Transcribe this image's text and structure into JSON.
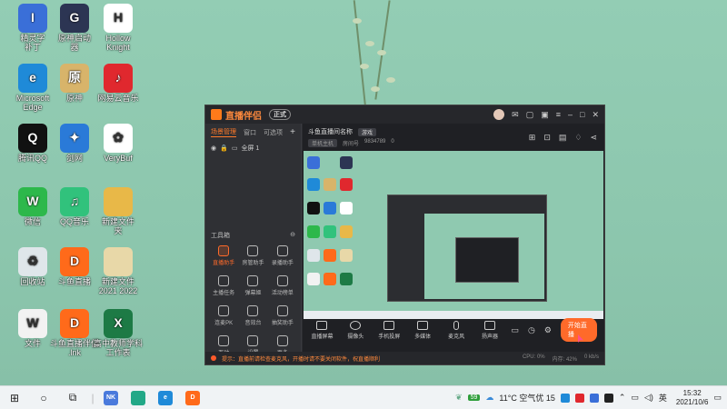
{
  "desktop": {
    "icons": [
      {
        "label": "精灵字\n补丁",
        "color": "#3a6fd8",
        "glyph": "I",
        "icon": "app-icon"
      },
      {
        "label": "原神启动\n器",
        "color": "#2c3553",
        "glyph": "G",
        "icon": "genshin-icon"
      },
      {
        "label": "Hollow\nKnight",
        "color": "#ffffff",
        "glyph": "H",
        "icon": "hollow-knight-icon"
      },
      {
        "label": "Microsoft\nEdge",
        "color": "#1f8ad8",
        "glyph": "e",
        "icon": "edge-icon"
      },
      {
        "label": "原神",
        "color": "#d8b46a",
        "glyph": "原",
        "icon": "genshin-game-icon"
      },
      {
        "label": "网易云音乐",
        "color": "#e0282e",
        "glyph": "♪",
        "icon": "netease-music-icon"
      },
      {
        "label": "腾讯QQ",
        "color": "#111111",
        "glyph": "Q",
        "icon": "qq-icon"
      },
      {
        "label": "剑网",
        "color": "#2a7ad8",
        "glyph": "✦",
        "icon": "game-icon"
      },
      {
        "label": "VeryBuf",
        "color": "#ffffff",
        "glyph": "✿",
        "icon": "pinwheel-icon"
      },
      {
        "label": "微信",
        "color": "#2db84b",
        "glyph": "W",
        "icon": "wechat-icon"
      },
      {
        "label": "QQ音乐",
        "color": "#31c27c",
        "glyph": "♫",
        "icon": "qq-music-icon"
      },
      {
        "label": "新建文件\n夹",
        "color": "#e8b848",
        "glyph": "",
        "icon": "folder-icon"
      },
      {
        "label": "回收站",
        "color": "#dfe6ea",
        "glyph": "♻",
        "icon": "recycle-bin-icon"
      },
      {
        "label": "斗鱼直播",
        "color": "#ff6a1a",
        "glyph": "D",
        "icon": "douyu-icon"
      },
      {
        "label": "新建文件\n2021 2022",
        "color": "#e8d8a8",
        "glyph": "",
        "icon": "document-icon"
      },
      {
        "label": "文件",
        "color": "#f2f2f2",
        "glyph": "W",
        "icon": "word-doc-icon"
      },
      {
        "label": "斗鱼直播伴侣\n.lnk",
        "color": "#ff6a1a",
        "glyph": "D",
        "icon": "douyu-companion-icon"
      },
      {
        "label": "高中教师学科\n工作表",
        "color": "#1d7a45",
        "glyph": "X",
        "icon": "excel-icon"
      }
    ]
  },
  "app": {
    "brand": "直播伴侣",
    "version": "正式",
    "tabs": [
      "场景管理",
      "窗口",
      "可选项"
    ],
    "scene_item": "全屏 1",
    "toolbox_title": "工具箱",
    "tools": [
      "直播助手",
      "房管助手",
      "录播助手",
      "主播任务",
      "弹幕姬",
      "活动榜单",
      "连麦PK",
      "音效台",
      "抽奖助手",
      "互动",
      "设置",
      "更多"
    ],
    "room": {
      "title": "斗鱼直播间名称",
      "tag": "游戏",
      "category": "单机主机",
      "meta": [
        "房间号",
        "9834789",
        "0"
      ]
    },
    "controls": [
      "直播屏幕",
      "摄像头",
      "手机投屏",
      "多媒体",
      "麦克风",
      "扬声器"
    ],
    "start_live": "开始直播",
    "status_notice": "提示：直播前请检查麦克风，开播时请不要关闭软件，祝直播顺利",
    "status_right": [
      "CPU: 0%",
      "内存: 42%",
      "0 kb/s"
    ]
  },
  "taskbar": {
    "apps": [
      {
        "label": "NK",
        "color": "#4a7adc"
      },
      {
        "label": "",
        "color": "#22a887"
      },
      {
        "label": "e",
        "color": "#1f8ad8"
      },
      {
        "label": "D",
        "color": "#ff6a1a"
      }
    ],
    "battery": "59",
    "weather": "11°C 空气优 15",
    "ime": "英",
    "time": "15:32",
    "date": "2021/10/6"
  }
}
